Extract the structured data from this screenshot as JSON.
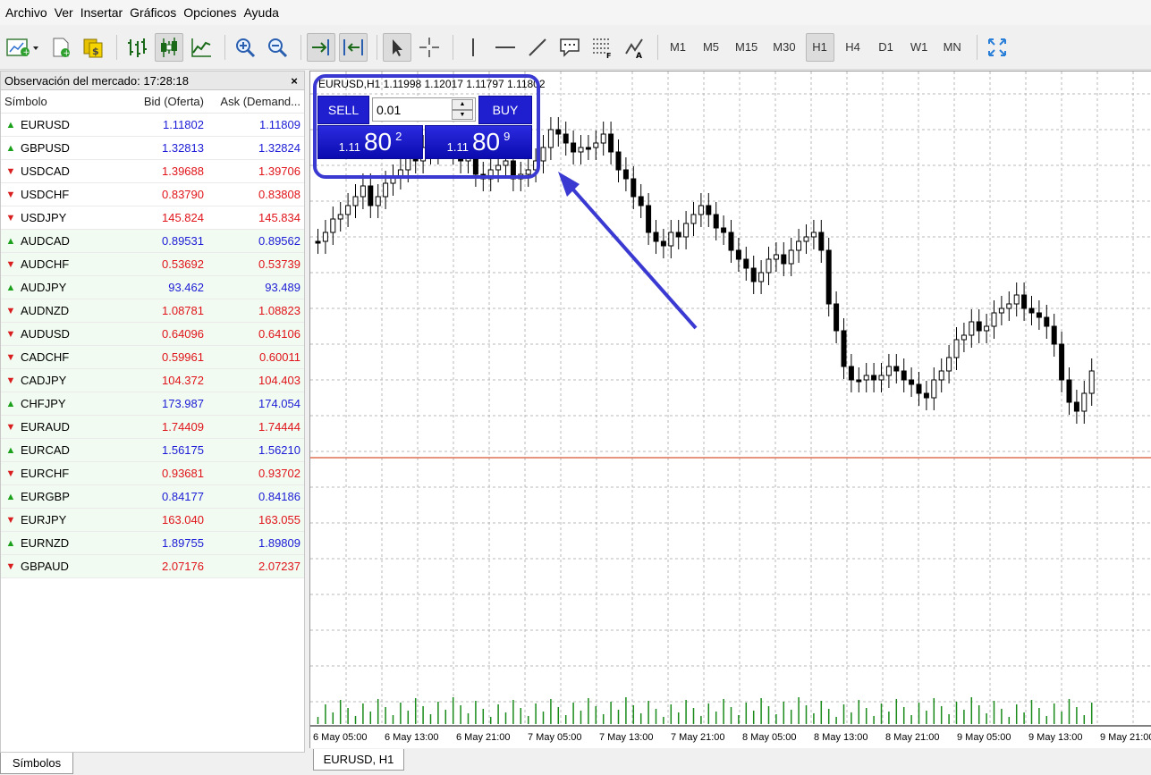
{
  "menu": [
    "Archivo",
    "Ver",
    "Insertar",
    "Gráficos",
    "Opciones",
    "Ayuda"
  ],
  "toolbar": {
    "icons": [
      "new-chart-icon",
      "new-profile-icon",
      "market-watch-icon",
      "bar-chart-icon",
      "candlestick-chart-icon",
      "line-chart-icon",
      "zoom-in-icon",
      "zoom-out-icon",
      "auto-scroll-icon",
      "chart-shift-icon",
      "cursor-icon",
      "crosshair-icon",
      "vertical-line-icon",
      "horizontal-line-icon",
      "trendline-icon",
      "text-label-icon",
      "fibonacci-icon",
      "objects-icon",
      "fullscreen-icon"
    ],
    "timeframes": [
      "M1",
      "M5",
      "M15",
      "M30",
      "H1",
      "H4",
      "D1",
      "W1",
      "MN"
    ],
    "active_timeframe": "H1"
  },
  "market_watch": {
    "title": "Observación del mercado: 17:28:18",
    "close": "×",
    "headers": {
      "symbol": "Símbolo",
      "bid": "Bid (Oferta)",
      "ask": "Ask (Demand..."
    },
    "rows": [
      {
        "symbol": "EURUSD",
        "dir": "up",
        "bid": "1.11802",
        "ask": "1.11809",
        "color": "blue"
      },
      {
        "symbol": "GBPUSD",
        "dir": "up",
        "bid": "1.32813",
        "ask": "1.32824",
        "color": "blue"
      },
      {
        "symbol": "USDCAD",
        "dir": "down",
        "bid": "1.39688",
        "ask": "1.39706",
        "color": "red"
      },
      {
        "symbol": "USDCHF",
        "dir": "down",
        "bid": "0.83790",
        "ask": "0.83808",
        "color": "red"
      },
      {
        "symbol": "USDJPY",
        "dir": "down",
        "bid": "145.824",
        "ask": "145.834",
        "color": "red"
      },
      {
        "symbol": "AUDCAD",
        "dir": "up",
        "bid": "0.89531",
        "ask": "0.89562",
        "color": "blue"
      },
      {
        "symbol": "AUDCHF",
        "dir": "down",
        "bid": "0.53692",
        "ask": "0.53739",
        "color": "red"
      },
      {
        "symbol": "AUDJPY",
        "dir": "up",
        "bid": "93.462",
        "ask": "93.489",
        "color": "blue"
      },
      {
        "symbol": "AUDNZD",
        "dir": "down",
        "bid": "1.08781",
        "ask": "1.08823",
        "color": "red"
      },
      {
        "symbol": "AUDUSD",
        "dir": "down",
        "bid": "0.64096",
        "ask": "0.64106",
        "color": "red"
      },
      {
        "symbol": "CADCHF",
        "dir": "down",
        "bid": "0.59961",
        "ask": "0.60011",
        "color": "red"
      },
      {
        "symbol": "CADJPY",
        "dir": "down",
        "bid": "104.372",
        "ask": "104.403",
        "color": "red"
      },
      {
        "symbol": "CHFJPY",
        "dir": "up",
        "bid": "173.987",
        "ask": "174.054",
        "color": "blue"
      },
      {
        "symbol": "EURAUD",
        "dir": "down",
        "bid": "1.74409",
        "ask": "1.74444",
        "color": "red"
      },
      {
        "symbol": "EURCAD",
        "dir": "up",
        "bid": "1.56175",
        "ask": "1.56210",
        "color": "blue"
      },
      {
        "symbol": "EURCHF",
        "dir": "down",
        "bid": "0.93681",
        "ask": "0.93702",
        "color": "red"
      },
      {
        "symbol": "EURGBP",
        "dir": "up",
        "bid": "0.84177",
        "ask": "0.84186",
        "color": "blue"
      },
      {
        "symbol": "EURJPY",
        "dir": "down",
        "bid": "163.040",
        "ask": "163.055",
        "color": "red"
      },
      {
        "symbol": "EURNZD",
        "dir": "up",
        "bid": "1.89755",
        "ask": "1.89809",
        "color": "blue"
      },
      {
        "symbol": "GBPAUD",
        "dir": "down",
        "bid": "2.07176",
        "ask": "2.07237",
        "color": "red"
      }
    ],
    "tab": "Símbolos"
  },
  "chart": {
    "info": "EURUSD,H1  1.11998 1.12017 1.11797 1.11802",
    "tab": "EURUSD, H1",
    "x_labels": [
      "6 May 05:00",
      "6 May 13:00",
      "6 May 21:00",
      "7 May 05:00",
      "7 May 13:00",
      "7 May 21:00",
      "8 May 05:00",
      "8 May 13:00",
      "8 May 21:00",
      "9 May 05:00",
      "9 May 13:00",
      "9 May 21:00"
    ],
    "colors": {
      "grid": "#b8b8b8",
      "candle": "#000000",
      "bid_line": "#e07050",
      "volume": "#1a8a1a",
      "highlight": "#3a3ad2"
    }
  },
  "trade_panel": {
    "sell_label": "SELL",
    "buy_label": "BUY",
    "lot": "0.01",
    "sell_price": {
      "small": "1.11",
      "big": "80",
      "sup": "2"
    },
    "buy_price": {
      "small": "1.11",
      "big": "80",
      "sup": "9"
    }
  },
  "chart_data": {
    "type": "candlestick",
    "symbol": "EURUSD",
    "timeframe": "H1",
    "x_labels": [
      "6 May 05:00",
      "6 May 13:00",
      "6 May 21:00",
      "7 May 05:00",
      "7 May 13:00",
      "7 May 21:00",
      "8 May 05:00",
      "8 May 13:00",
      "8 May 21:00",
      "9 May 05:00",
      "9 May 13:00",
      "9 May 21:00"
    ],
    "last": {
      "open": 1.11998,
      "high": 1.12017,
      "low": 1.11797,
      "close": 1.11802
    }
  }
}
